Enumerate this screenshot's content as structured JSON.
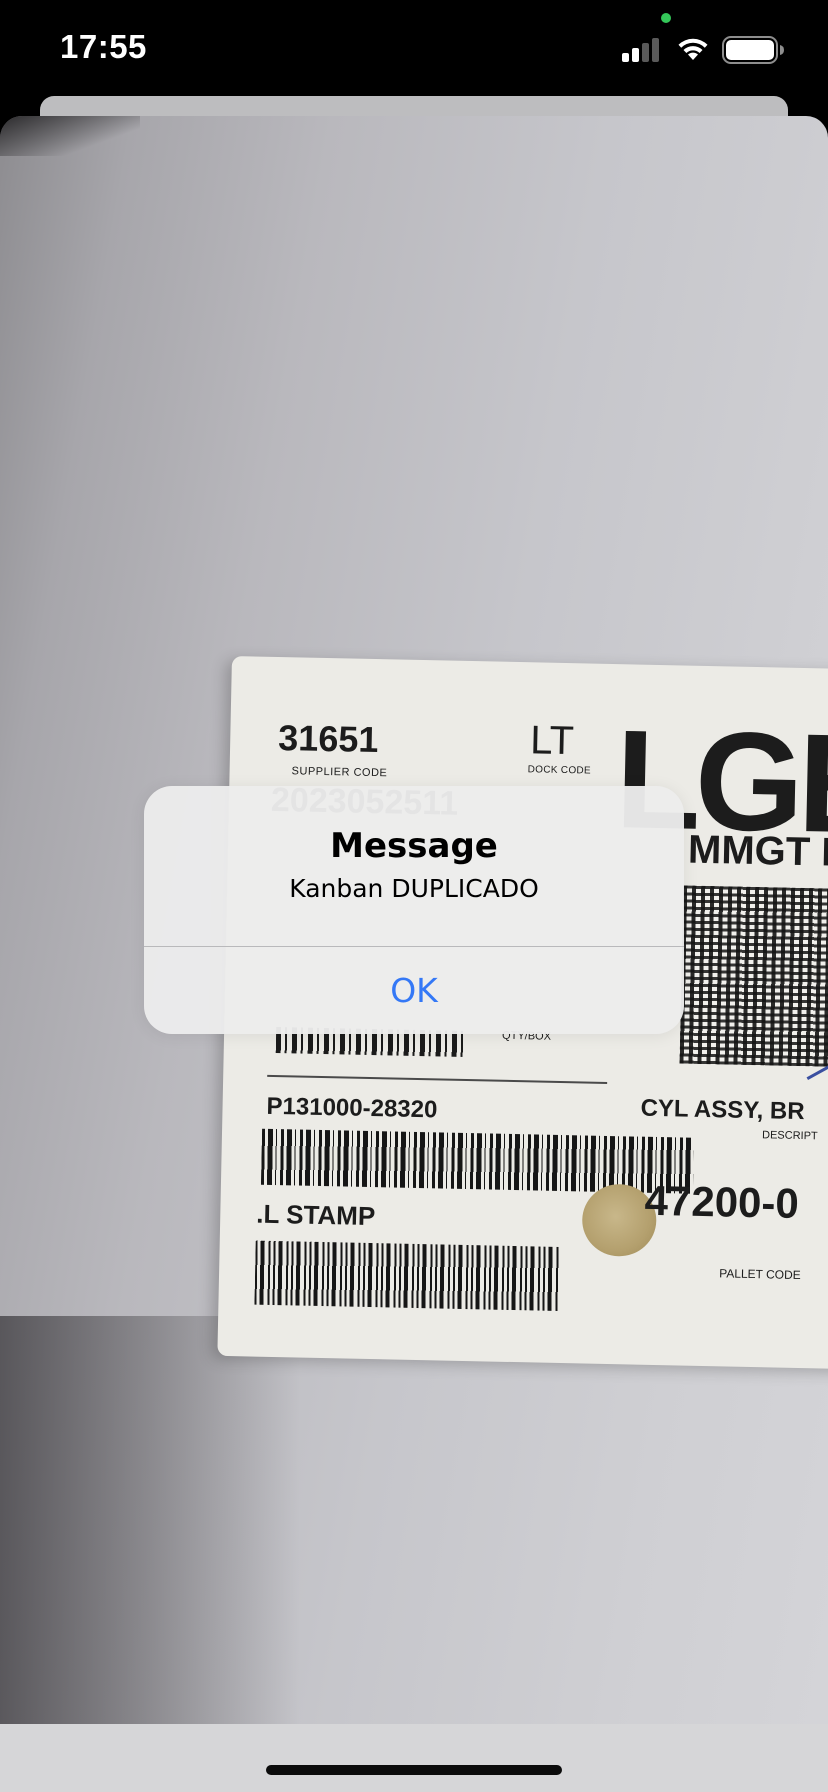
{
  "status_bar": {
    "time": "17:55",
    "privacy_dot_color": "#34c759",
    "signal_icon": "cellular-signal-icon",
    "wifi_icon": "wifi-icon",
    "battery_icon": "battery-full-icon"
  },
  "camera_label": {
    "supplier_code": "31651",
    "supplier_caption": "SUPPLIER CODE",
    "date_code": "2023052511",
    "dock_code": "LT",
    "dock_caption": "DOCK CODE",
    "logo_text": "LGE",
    "kanban_partial": "MMGT KA",
    "qty_caption": "QTY/BOX",
    "part_number": "P131000-28320",
    "stamp_text": ".L STAMP",
    "description": "CYL ASSY, BR",
    "description_caption": "DESCRIPT",
    "number": "47200-0",
    "pallet_caption": "PALLET CODE"
  },
  "alert": {
    "title": "Message",
    "message": "Kanban DUPLICADO",
    "ok_label": "OK",
    "ok_color": "#3478f6"
  }
}
